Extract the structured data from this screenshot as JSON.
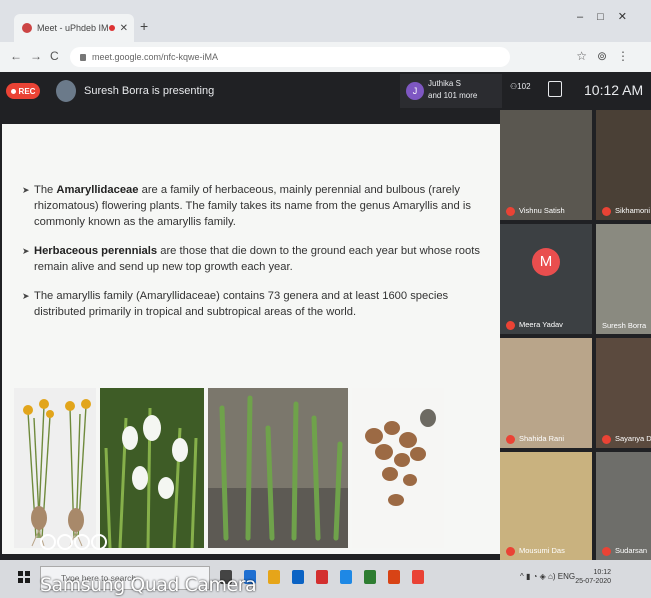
{
  "browser": {
    "tab_title": "Meet - uPhdeb IM6",
    "url": "meet.google.com/nfc-kqwe-iMA"
  },
  "meet": {
    "rec_label": "REC",
    "presenting_text": "Suresh Borra is presenting",
    "joined_name": "Juthika S",
    "joined_more": "and 101 more",
    "people_count": "102",
    "time": "10:12 AM"
  },
  "slide": {
    "bullets": [
      {
        "pre": "The ",
        "bold": "Amaryllidaceae",
        "post": " are a family of herbaceous, mainly perennial and bulbous (rarely rhizomatous) flowering plants. The family takes its name from the genus Amaryllis and is commonly known as the amaryllis family."
      },
      {
        "pre": "",
        "bold": "Herbaceous perennials",
        "post": " are those that die down to the ground each year but whose roots remain alive and send up new top growth each year."
      },
      {
        "pre": "",
        "bold": "",
        "post": "The amaryllis family (Amaryllidaceae) contains 73 genera and at least 1600 species distributed primarily in tropical and subtropical areas of the world."
      }
    ]
  },
  "participants": [
    {
      "name": "Vishnu Satish"
    },
    {
      "name": "Sikhamoni"
    },
    {
      "name": "Meera Yadav",
      "initial": "M"
    },
    {
      "name": "Suresh Borra"
    },
    {
      "name": "Shahida Rani"
    },
    {
      "name": "Sayanya Das"
    },
    {
      "name": "Mousumi Das"
    },
    {
      "name": "Sudarsan"
    }
  ],
  "taskbar": {
    "search_placeholder": "Type here to search",
    "tray_time": "10:12",
    "tray_date": "25-07-2020",
    "tray_lang": "ENG"
  },
  "watermark": "Samsung Quad Camera",
  "colors": {
    "rec": "#ea4335",
    "meet_bg": "#202124",
    "avatar_m": "#e94e4e"
  }
}
